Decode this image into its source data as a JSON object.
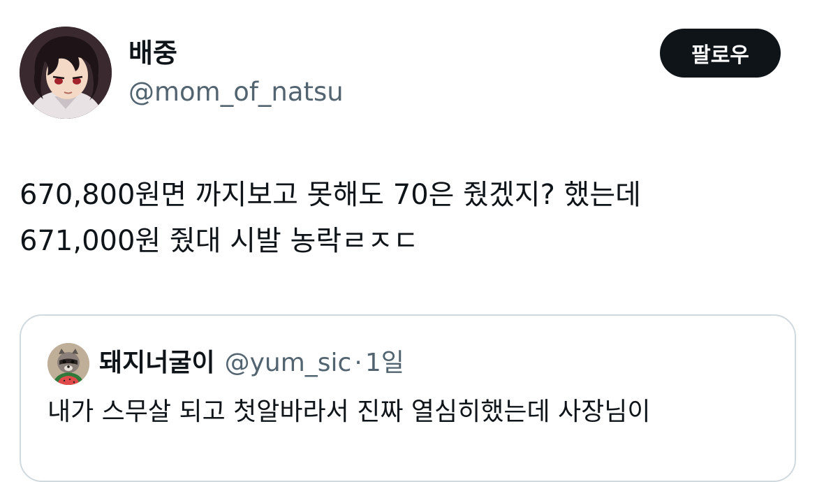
{
  "author": {
    "display_name": "배중",
    "handle": "@mom_of_natsu",
    "avatar_icon": "anime-avatar-icon"
  },
  "follow_button": {
    "label": "팔로우",
    "background": "#0f1419",
    "text_color": "#ffffff"
  },
  "tweet": {
    "lines": [
      "670,800원면 까지보고 못해도 70은 줬겠지? 했는데",
      "671,000원 줬대 시발 농락ㄹㅈㄷ"
    ]
  },
  "quote": {
    "display_name": "돼지너굴이",
    "handle": "@yum_sic",
    "separator": "·",
    "time": "1일",
    "avatar_icon": "raccoon-avatar-icon",
    "text": "내가 스무살 되고 첫알바라서 진짜 열심히했는데 사장님이"
  },
  "colors": {
    "text_primary": "#0f1419",
    "text_secondary": "#536471",
    "border": "#cfd9de"
  }
}
